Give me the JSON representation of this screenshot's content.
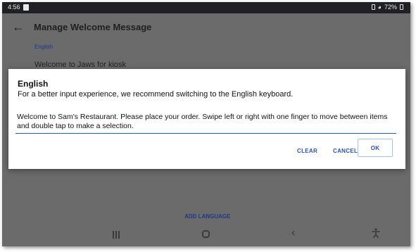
{
  "status": {
    "time": "4:56",
    "battery": "72%"
  },
  "appbar": {
    "title": "Manage Welcome Message"
  },
  "background": {
    "language_label": "English",
    "welcome_text": "Welcome to Jaws for kiosk"
  },
  "dialog": {
    "title": "English",
    "hint": "For a better input experience, we recommend switching to the English keyboard.",
    "input_value": "Welcome to Sam's Restaurant. Please place your order. Swipe left or right with one finger to move between items and double tap to make a selection.",
    "clear_label": "CLEAR",
    "cancel_label": "CANCEL",
    "ok_label": "OK"
  },
  "add_language_label": "ADD LANGUAGE",
  "colors": {
    "accent": "#2a4fc0",
    "input_underline": "#2a55c9",
    "scrim": "#6b6b6b"
  }
}
